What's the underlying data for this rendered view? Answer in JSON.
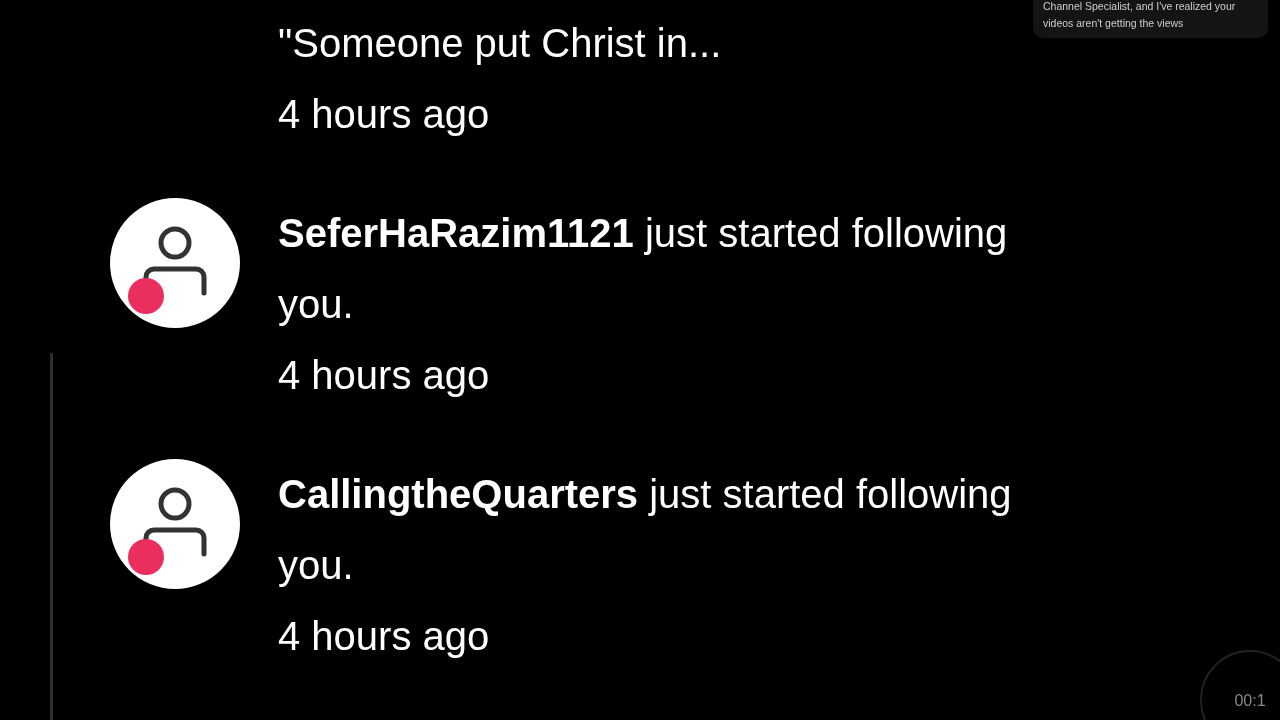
{
  "notifications": [
    {
      "kind": "comment",
      "message": "\"Someone put Christ in...",
      "time": "4 hours ago"
    },
    {
      "kind": "follow",
      "name": "SeferHaRazim1121",
      "message": "just started following you.",
      "time": "4 hours ago"
    },
    {
      "kind": "follow",
      "name": "CallingtheQuarters",
      "message": "just started following you.",
      "time": "4 hours ago"
    }
  ],
  "popup": {
    "text": "Channel Specialist, and I've realized your videos aren't getting the views"
  },
  "timer": {
    "text": "00:1"
  }
}
